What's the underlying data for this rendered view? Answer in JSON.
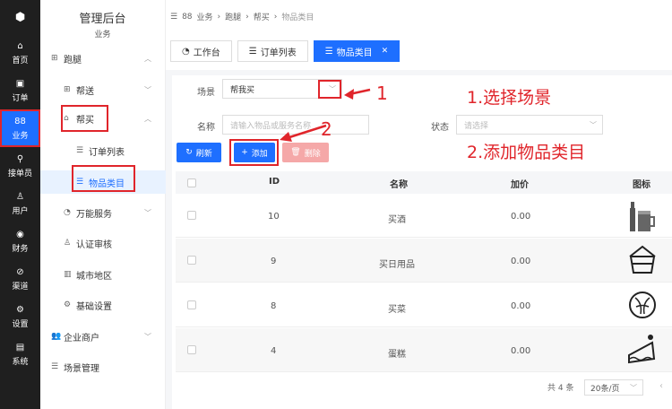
{
  "rail": {
    "items": [
      {
        "icon": "⌂",
        "label": "首页"
      },
      {
        "icon": "▣",
        "label": "订单"
      },
      {
        "icon": "88",
        "label": "业务"
      },
      {
        "icon": "⚲",
        "label": "接单员"
      },
      {
        "icon": "♙",
        "label": "用户"
      },
      {
        "icon": "◉",
        "label": "财务"
      },
      {
        "icon": "⊘",
        "label": "渠道"
      },
      {
        "icon": "⚙",
        "label": "设置"
      },
      {
        "icon": "▤",
        "label": "系统"
      }
    ]
  },
  "sidebar": {
    "title": "管理后台",
    "subtitle": "业务",
    "items": [
      {
        "label": "跑腿"
      },
      {
        "label": "帮送"
      },
      {
        "label": "帮买"
      },
      {
        "label": "订单列表"
      },
      {
        "label": "物品类目"
      },
      {
        "label": "万能服务"
      },
      {
        "label": "认证审核"
      },
      {
        "label": "城市地区"
      },
      {
        "label": "基础设置"
      },
      {
        "label": "企业商户"
      },
      {
        "label": "场景管理"
      }
    ]
  },
  "breadcrumb": {
    "items": [
      "业务",
      "跑腿",
      "帮买",
      "物品类目"
    ]
  },
  "tabs": [
    {
      "label": "工作台"
    },
    {
      "label": "订单列表"
    },
    {
      "label": "物品类目"
    }
  ],
  "filters": {
    "scene_label": "场景",
    "scene_value": "帮我买",
    "name_label": "名称",
    "name_placeholder": "请输入物品或服务名称",
    "status_label": "状态",
    "status_placeholder": "请选择"
  },
  "toolbar": {
    "refresh": "刷新",
    "add": "添加",
    "delete": "删除"
  },
  "annotations": {
    "n1": "1",
    "n2": "2",
    "step1": "1.选择场景",
    "step2": "2.添加物品类目"
  },
  "table": {
    "headers": {
      "id": "ID",
      "name": "名称",
      "price": "加价",
      "icon": "图标"
    },
    "rows": [
      {
        "id": "10",
        "name": "买酒",
        "price": "0.00",
        "icon": "beer-icon"
      },
      {
        "id": "9",
        "name": "买日用品",
        "price": "0.00",
        "icon": "basket-icon"
      },
      {
        "id": "8",
        "name": "买菜",
        "price": "0.00",
        "icon": "cabbage-icon"
      },
      {
        "id": "4",
        "name": "蛋糕",
        "price": "0.00",
        "icon": "cake-icon"
      }
    ]
  },
  "pagination": {
    "total": "共 4 条",
    "page_size": "20条/页"
  },
  "colors": {
    "accent": "#1e6fff",
    "annotation_red": "#e0252b",
    "rail_bg": "#1f1f1f"
  }
}
